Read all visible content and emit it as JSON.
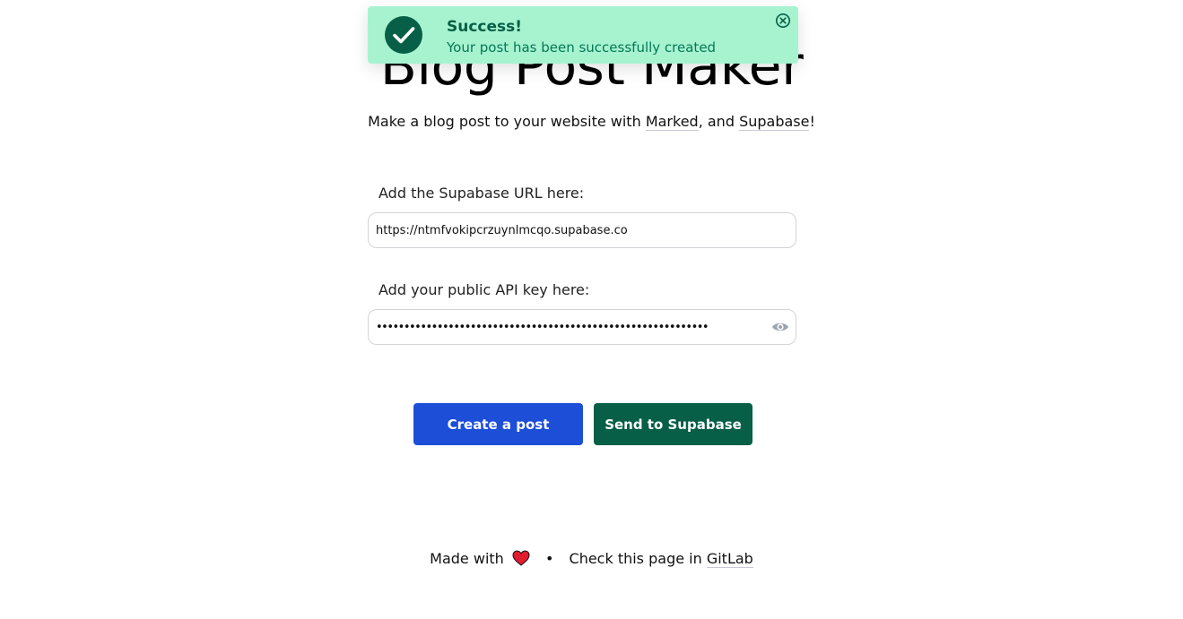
{
  "page": {
    "title": "Blog Post Maker",
    "subtitle_prefix": "Make a blog post to your website with ",
    "subtitle_link1": "Marked",
    "subtitle_middle": ", and ",
    "subtitle_link2": "Supabase",
    "subtitle_suffix": "!"
  },
  "form": {
    "url_label": "Add the Supabase URL here:",
    "url_value": "https://ntmfvokipcrzuynlmcqo.supabase.co",
    "key_label": "Add your public API key here:",
    "key_value": "••••••••••••••••••••••••••••••••••••••••••••••••••••••••••••",
    "key_visibility_icon": "eye-icon"
  },
  "buttons": {
    "create_label": "Create a post",
    "send_label": "Send to Supabase"
  },
  "footer": {
    "made_with": "Made with",
    "heart_icon": "heart-icon",
    "separator": "•",
    "check_text": "Check this page in ",
    "gitlab_link": "GitLab"
  },
  "toast": {
    "title": "Success!",
    "message": "Your post has been successfully created",
    "icon": "check-circle-icon",
    "close_icon": "close-icon"
  },
  "colors": {
    "toast_bg": "#a7f3d0",
    "toast_text": "#065f46",
    "create_button": "#1d4ed8",
    "send_button": "#065f46"
  }
}
